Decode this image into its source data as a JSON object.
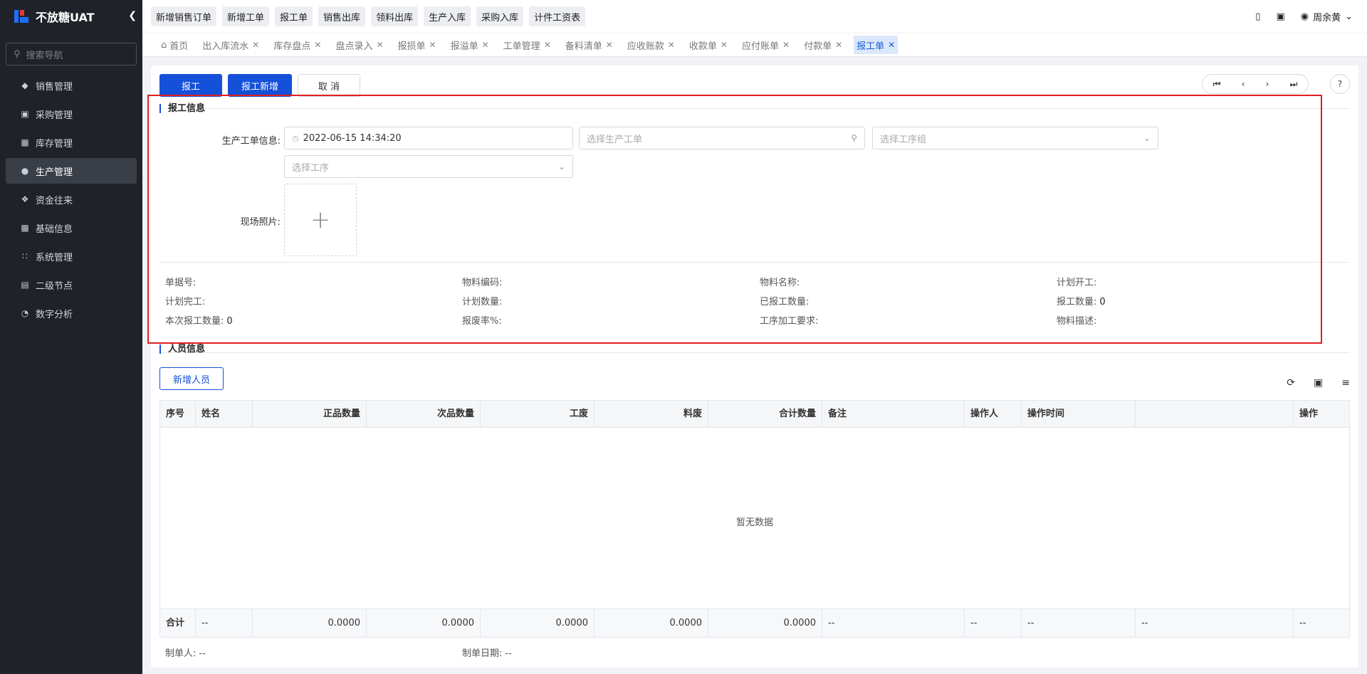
{
  "sidebar": {
    "brand": "不放糖UAT",
    "search_placeholder": "搜索导航",
    "items": [
      {
        "label": "销售管理"
      },
      {
        "label": "采购管理"
      },
      {
        "label": "库存管理"
      },
      {
        "label": "生产管理",
        "active": true
      },
      {
        "label": "资金往来"
      },
      {
        "label": "基础信息"
      },
      {
        "label": "系统管理"
      },
      {
        "label": "二级节点"
      },
      {
        "label": "数字分析"
      }
    ]
  },
  "topbar": {
    "quick_links": [
      "新增销售订单",
      "新增工单",
      "报工单",
      "销售出库",
      "领料出库",
      "生产入库",
      "采购入库",
      "计件工资表"
    ],
    "user": "周余黄"
  },
  "tabs": [
    {
      "label": "首页",
      "closable": false
    },
    {
      "label": "出入库流水",
      "closable": true
    },
    {
      "label": "库存盘点",
      "closable": true
    },
    {
      "label": "盘点录入",
      "closable": true
    },
    {
      "label": "报损单",
      "closable": true
    },
    {
      "label": "报溢单",
      "closable": true
    },
    {
      "label": "工单管理",
      "closable": true
    },
    {
      "label": "备料清单",
      "closable": true
    },
    {
      "label": "应收账款",
      "closable": true
    },
    {
      "label": "收款单",
      "closable": true
    },
    {
      "label": "应付账单",
      "closable": true
    },
    {
      "label": "付款单",
      "closable": true
    },
    {
      "label": "报工单",
      "closable": true,
      "active": true
    }
  ],
  "actions": {
    "report": "报工",
    "report_new": "报工新增",
    "cancel": "取 消"
  },
  "report_info": {
    "title": "报工信息",
    "order_label": "生产工单信息:",
    "datetime": "2022-06-15 14:34:20",
    "order_placeholder": "选择生产工单",
    "process_group_placeholder": "选择工序组",
    "process_placeholder": "选择工序",
    "photo_label": "现场照片:",
    "fields": [
      {
        "label": "单据号:",
        "value": ""
      },
      {
        "label": "物料编码:",
        "value": ""
      },
      {
        "label": "物料名称:",
        "value": ""
      },
      {
        "label": "计划开工:",
        "value": ""
      },
      {
        "label": "计划完工:",
        "value": ""
      },
      {
        "label": "计划数量:",
        "value": ""
      },
      {
        "label": "已报工数量:",
        "value": ""
      },
      {
        "label": "报工数量:",
        "value": "0"
      },
      {
        "label": "本次报工数量:",
        "value": "0"
      },
      {
        "label": "报废率%:",
        "value": ""
      },
      {
        "label": "工序加工要求:",
        "value": ""
      },
      {
        "label": "物料描述:",
        "value": ""
      }
    ]
  },
  "personnel": {
    "title": "人员信息",
    "add_button": "新增人员",
    "columns": [
      "序号",
      "姓名",
      "正品数量",
      "次品数量",
      "工废",
      "料废",
      "合计数量",
      "备注",
      "操作人",
      "操作时间",
      "",
      "操作"
    ],
    "empty_text": "暂无数据",
    "totals": [
      "合计",
      "--",
      "0.0000",
      "0.0000",
      "0.0000",
      "0.0000",
      "0.0000",
      "--",
      "--",
      "--",
      "--",
      "--"
    ]
  },
  "footer": {
    "creator_label": "制单人:",
    "creator_value": "--",
    "date_label": "制单日期:",
    "date_value": "--"
  },
  "colors": {
    "primary": "#1550d8",
    "sidebar_bg": "#1f2329",
    "highlight": "#e02020"
  }
}
